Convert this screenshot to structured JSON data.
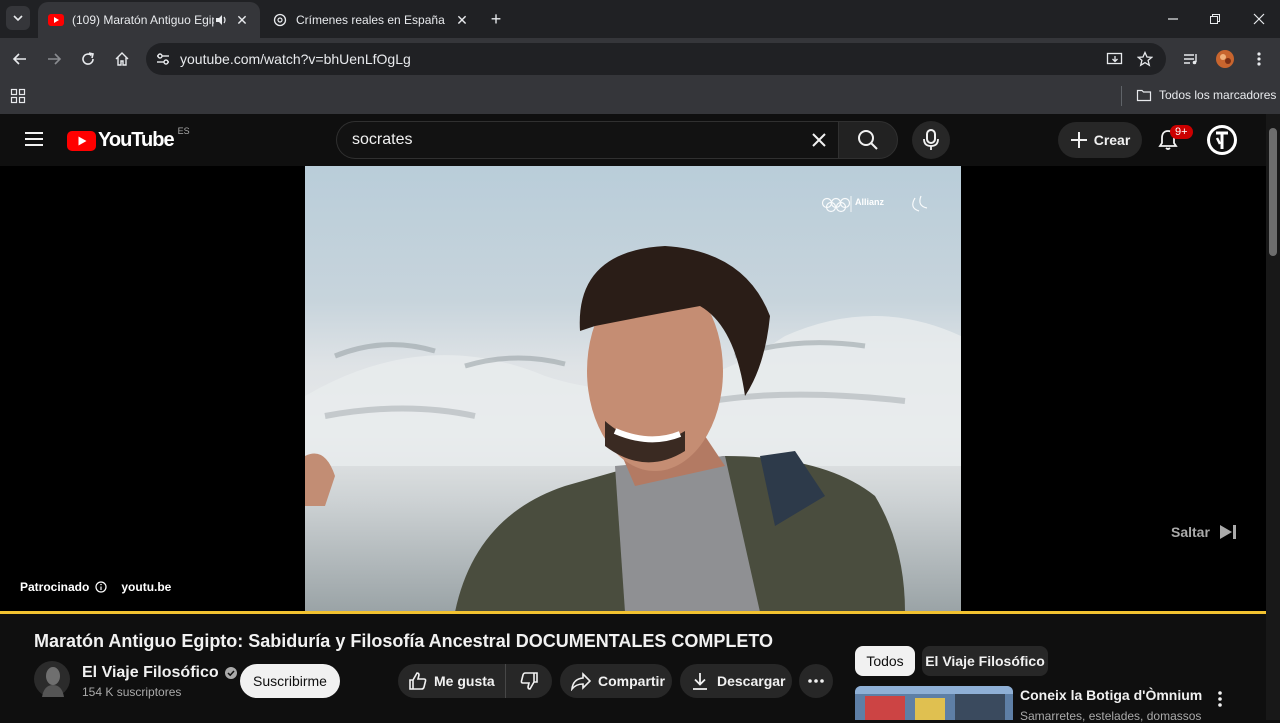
{
  "browser": {
    "tabs": [
      {
        "title": "(109) Maratón Antiguo Egip",
        "active": true
      },
      {
        "title": "Crímenes reales en España",
        "active": false
      }
    ],
    "url": "youtube.com/watch?v=bhUenLfOgLg",
    "bookmarks_folder": "Todos los marcadores"
  },
  "youtube": {
    "logo_text": "YouTube",
    "region": "ES",
    "search_query": "socrates",
    "create_label": "Crear",
    "notifications_badge": "9+",
    "ad": {
      "sponsored_label": "Patrocinado",
      "link": "youtu.be",
      "skip_label": "Saltar",
      "brand_text": "Allianz"
    },
    "video": {
      "title": "Maratón Antiguo Egipto: Sabiduría y Filosofía Ancestral DOCUMENTALES COMPLETO",
      "channel": "El Viaje Filosófico",
      "subscribers": "154 K suscriptores",
      "subscribe_label": "Suscribirme",
      "like_label": "Me gusta",
      "share_label": "Compartir",
      "download_label": "Descargar"
    },
    "chips": [
      "Todos",
      "El Viaje Filosófico"
    ],
    "recommended": [
      {
        "title": "Coneix la Botiga d'Òmnium",
        "subtitle": "Samarretes, estelades, domassos"
      }
    ]
  },
  "colors": {
    "brand_red": "#ff0000",
    "progress": "#f2c230",
    "badge": "#cc0000"
  }
}
